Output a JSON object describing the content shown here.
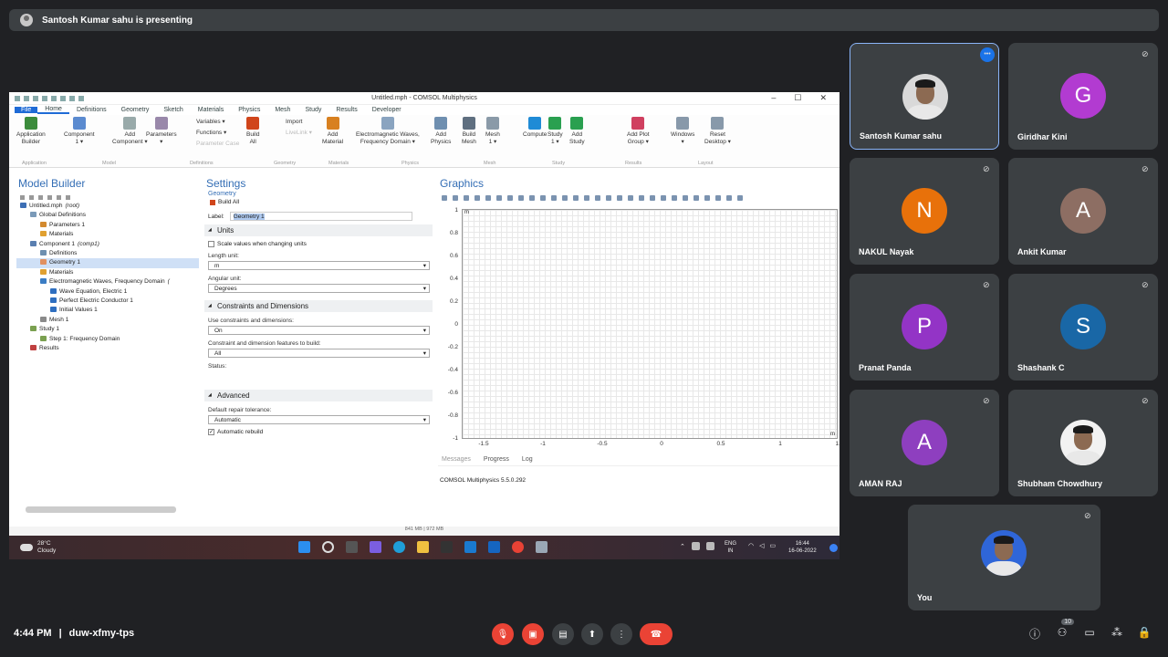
{
  "meeting": {
    "banner": "Santosh Kumar sahu is presenting",
    "time": "4:44 PM",
    "separator": "|",
    "code": "duw-xfmy-tps",
    "people_count": "10",
    "colors": {
      "background": "#202124",
      "tile": "#3c4043",
      "end_call": "#ea4335",
      "muted": "#ea4335",
      "active_border": "#8ab4f8"
    }
  },
  "comsol": {
    "title": "Untitled.mph - COMSOL Multiphysics",
    "menu": [
      "File",
      "Home",
      "Definitions",
      "Geometry",
      "Sketch",
      "Materials",
      "Physics",
      "Mesh",
      "Study",
      "Results",
      "Developer"
    ],
    "ribbon": [
      {
        "label": "Application\nBuilder"
      },
      {
        "label": "Component\n1 ▾"
      },
      {
        "label": "Add\nComponent ▾"
      },
      {
        "label": "Parameters\n▾"
      },
      {
        "label": "Build\nAll"
      },
      {
        "label": "Add\nMaterial"
      },
      {
        "label": "Electromagnetic Waves,\nFrequency Domain ▾"
      },
      {
        "label": "Add\nPhysics"
      },
      {
        "label": "Build\nMesh"
      },
      {
        "label": "Mesh\n1 ▾"
      },
      {
        "label": "Compute"
      },
      {
        "label": "Study\n1 ▾"
      },
      {
        "label": "Add\nStudy"
      },
      {
        "label": "Add Plot\nGroup ▾"
      },
      {
        "label": "Windows\n▾"
      },
      {
        "label": "Reset\nDesktop ▾"
      }
    ],
    "ribbon_small": [
      "Variables ▾",
      "Functions ▾",
      "Parameter Case",
      "Import",
      "LiveLink ▾"
    ],
    "ribbon_groups": [
      "Application",
      "Model",
      "Definitions",
      "Geometry",
      "Materials",
      "Physics",
      "Mesh",
      "Study",
      "Results",
      "Layout"
    ],
    "model_builder": {
      "title": "Model Builder",
      "tree": [
        {
          "label": "Untitled.mph",
          "tag": "(root)",
          "level": 0
        },
        {
          "label": "Global Definitions",
          "level": 1
        },
        {
          "label": "Parameters 1",
          "level": 2
        },
        {
          "label": "Materials",
          "level": 2
        },
        {
          "label": "Component 1",
          "tag": "(comp1)",
          "level": 1
        },
        {
          "label": "Definitions",
          "level": 2
        },
        {
          "label": "Geometry 1",
          "level": 2,
          "selected": true
        },
        {
          "label": "Materials",
          "level": 2
        },
        {
          "label": "Electromagnetic Waves, Frequency Domain",
          "tag": "(",
          "level": 2
        },
        {
          "label": "Wave Equation, Electric 1",
          "level": 3
        },
        {
          "label": "Perfect Electric Conductor 1",
          "level": 3
        },
        {
          "label": "Initial Values 1",
          "level": 3
        },
        {
          "label": "Mesh 1",
          "level": 2
        },
        {
          "label": "Study 1",
          "level": 1
        },
        {
          "label": "Step 1: Frequency Domain",
          "level": 2
        },
        {
          "label": "Results",
          "level": 1
        }
      ]
    },
    "settings": {
      "title": "Settings",
      "subtitle": "Geometry",
      "build_all": "Build All",
      "label_caption": "Label:",
      "label_value": "Geometry 1",
      "units_section": "Units",
      "scale_values": "Scale values when changing units",
      "length_unit_caption": "Length unit:",
      "length_unit": "m",
      "angular_unit_caption": "Angular unit:",
      "angular_unit": "Degrees",
      "constraints_section": "Constraints and Dimensions",
      "use_constraints_caption": "Use constraints and dimensions:",
      "use_constraints": "On",
      "features_caption": "Constraint and dimension features to build:",
      "features": "All",
      "status_caption": "Status:",
      "advanced_section": "Advanced",
      "repair_caption": "Default repair tolerance:",
      "repair": "Automatic",
      "auto_rebuild": "Automatic rebuild"
    },
    "graphics": {
      "title": "Graphics",
      "y_unit": "m",
      "x_unit": "m",
      "y_ticks": [
        "1",
        "0.8",
        "0.6",
        "0.4",
        "0.2",
        "0",
        "-0.2",
        "-0.4",
        "-0.6",
        "-0.8",
        "-1"
      ],
      "x_ticks": [
        "-1.5",
        "-1",
        "-0.5",
        "0",
        "0.5",
        "1",
        "1.5"
      ]
    },
    "messages": {
      "tabs": [
        "Messages",
        "Progress",
        "Log"
      ],
      "text": "COMSOL Multiphysics 5.5.0.292"
    },
    "status": "841 MB | 972 MB"
  },
  "taskbar": {
    "weather_temp": "28°C",
    "weather_desc": "Cloudy",
    "lang": "ENG",
    "region": "IN",
    "clock": "16:44",
    "date": "16-06-2022"
  },
  "participants": [
    {
      "name": "Santosh Kumar sahu",
      "initial": "",
      "color": "",
      "photo": true
    },
    {
      "name": "Giridhar Kini",
      "initial": "G",
      "color": "#b23bd1"
    },
    {
      "name": "NAKUL Nayak",
      "initial": "N",
      "color": "#e8710a"
    },
    {
      "name": "Ankit Kumar",
      "initial": "A",
      "color": "#8d6e63"
    },
    {
      "name": "Pranat Panda",
      "initial": "P",
      "color": "#9334c6"
    },
    {
      "name": "Shashank C",
      "initial": "S",
      "color": "#1967a6"
    },
    {
      "name": "AMAN RAJ",
      "initial": "A",
      "color": "#8e3fbf"
    },
    {
      "name": "Shubham Chowdhury",
      "initial": "",
      "color": "",
      "photo": true
    },
    {
      "name": "You",
      "initial": "",
      "color": "",
      "photo": true
    }
  ]
}
